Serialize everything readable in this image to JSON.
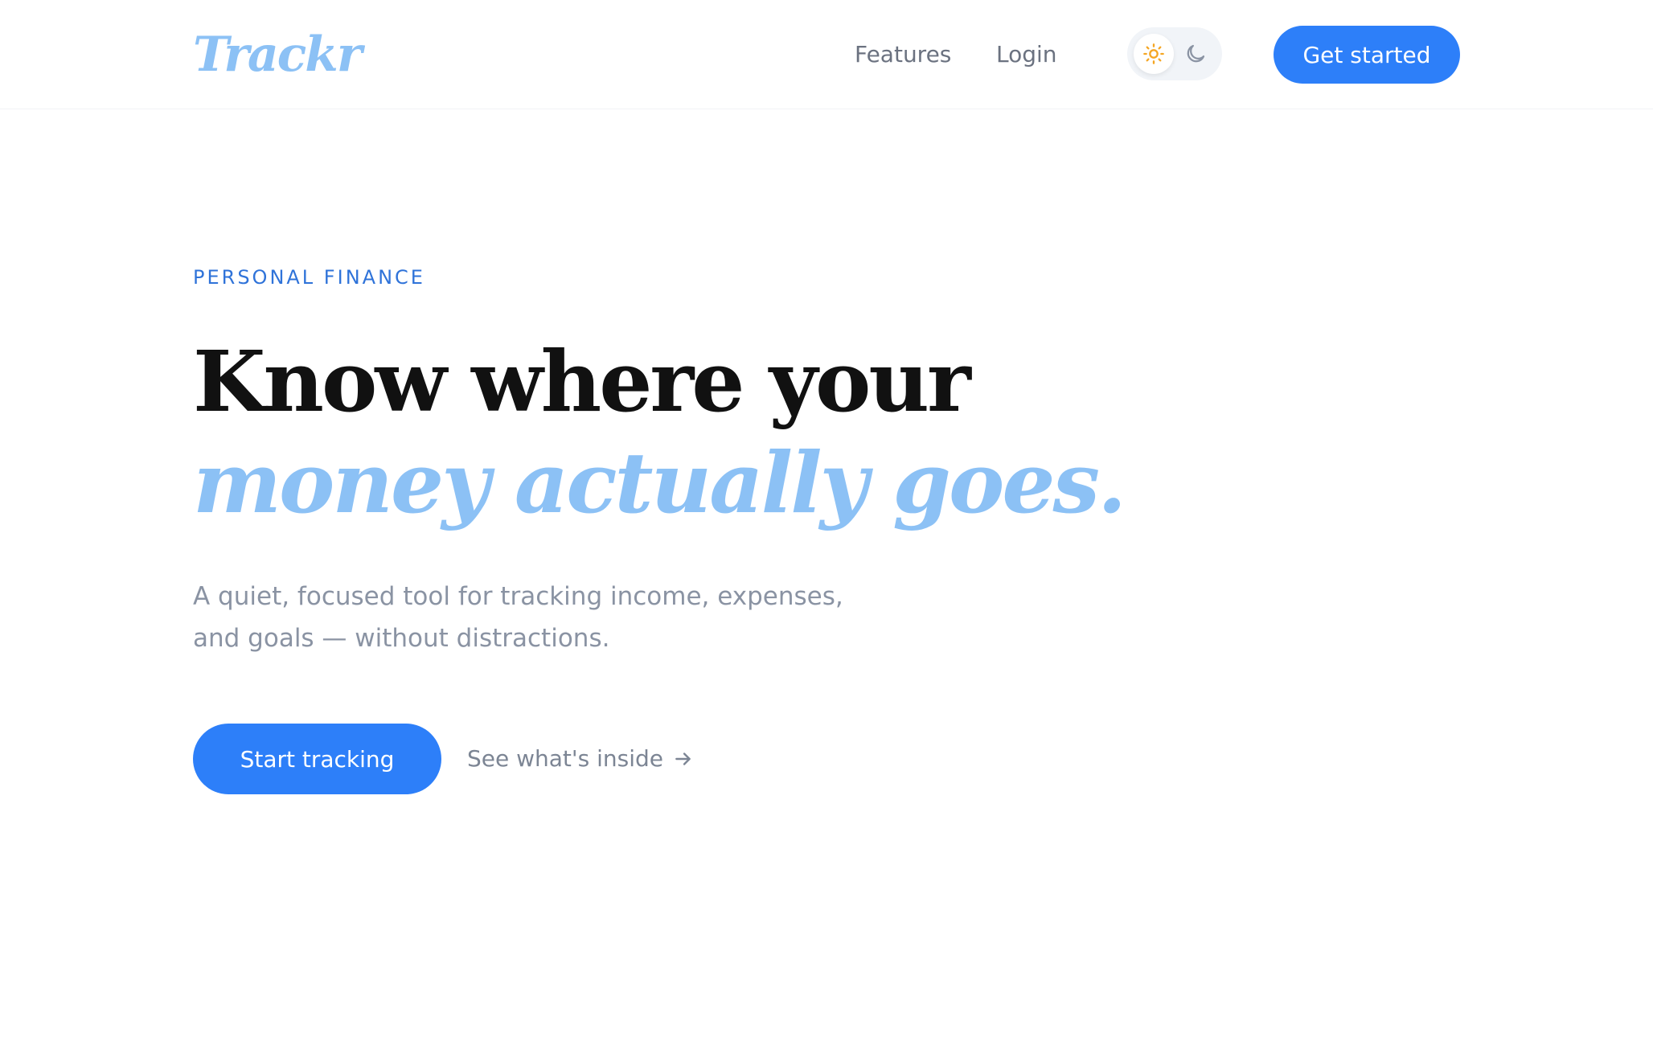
{
  "header": {
    "logo": "Trackr",
    "nav": {
      "features_label": "Features",
      "login_label": "Login"
    },
    "theme_toggle": {
      "light_icon": "sun-icon",
      "dark_icon": "moon-icon",
      "selected": "light"
    },
    "cta_label": "Get started"
  },
  "hero": {
    "eyebrow": "PERSONAL FINANCE",
    "headline_line1": "Know where your",
    "headline_line2": "money actually goes.",
    "subtitle": "A quiet, focused tool for tracking income, expenses, and goals — without distractions.",
    "primary_cta_label": "Start tracking",
    "secondary_link_label": "See what's inside",
    "secondary_link_icon": "arrow-right-icon"
  },
  "colors": {
    "accent": "#2d7ff9",
    "logo_and_highlight": "#8cc1f5",
    "eyebrow": "#2f73d9",
    "sun": "#f5a623"
  }
}
